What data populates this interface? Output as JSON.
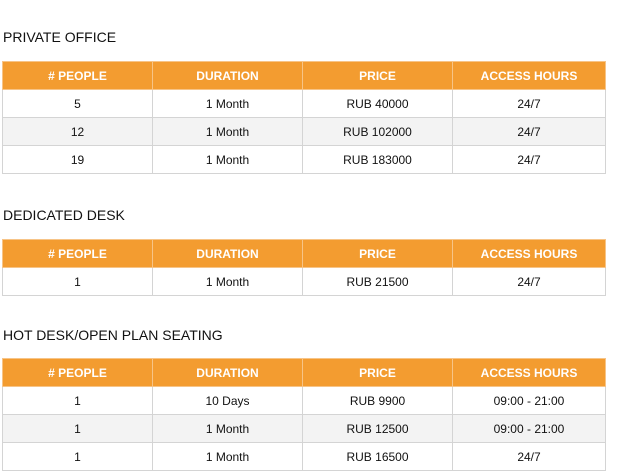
{
  "headers": [
    "# PEOPLE",
    "DURATION",
    "PRICE",
    "ACCESS HOURS"
  ],
  "sections": [
    {
      "title": "PRIVATE OFFICE",
      "rows": [
        [
          "5",
          "1 Month",
          "RUB 40000",
          "24/7"
        ],
        [
          "12",
          "1 Month",
          "RUB 102000",
          "24/7"
        ],
        [
          "19",
          "1 Month",
          "RUB 183000",
          "24/7"
        ]
      ]
    },
    {
      "title": "DEDICATED DESK",
      "rows": [
        [
          "1",
          "1 Month",
          "RUB 21500",
          "24/7"
        ]
      ]
    },
    {
      "title": "HOT DESK/OPEN PLAN SEATING",
      "rows": [
        [
          "1",
          "10 Days",
          "RUB 9900",
          "09:00 - 21:00"
        ],
        [
          "1",
          "1 Month",
          "RUB 12500",
          "09:00 - 21:00"
        ],
        [
          "1",
          "1 Month",
          "RUB 16500",
          "24/7"
        ]
      ]
    }
  ]
}
